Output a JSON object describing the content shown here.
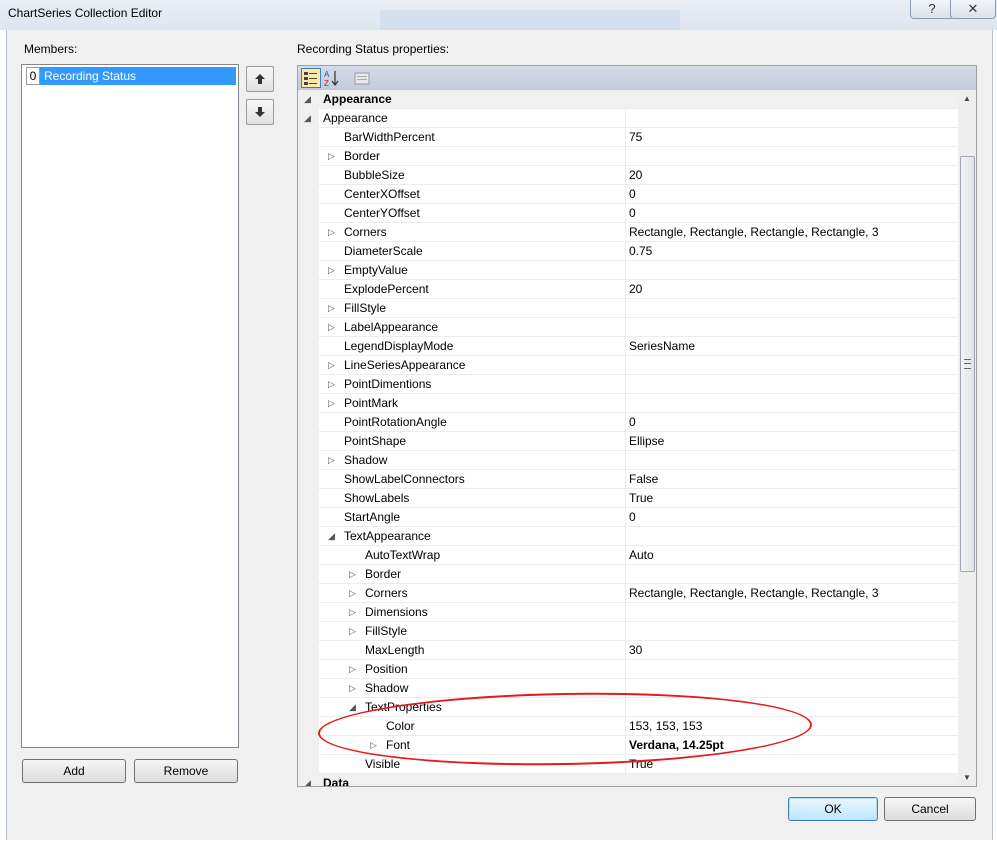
{
  "window": {
    "title": "ChartSeries Collection Editor",
    "help_glyph": "?",
    "close_glyph": "✕"
  },
  "members": {
    "label": "Members:",
    "items": [
      {
        "index": "0",
        "name": "Recording Status"
      }
    ],
    "move_up_icon": "arrow-up-icon",
    "move_down_icon": "arrow-down-icon"
  },
  "buttons": {
    "add": "Add",
    "remove": "Remove",
    "ok": "OK",
    "cancel": "Cancel"
  },
  "properties": {
    "label": "Recording Status properties:",
    "toolbar": [
      "categorized-icon",
      "alphabetical-icon",
      "property-pages-icon"
    ],
    "rows": [
      {
        "name": "Appearance",
        "value": "",
        "level": 0,
        "expander": "collapse",
        "category": true
      },
      {
        "name": "Appearance",
        "value": "",
        "level": 0,
        "expander": "collapse"
      },
      {
        "name": "BarWidthPercent",
        "value": "75",
        "level": 1,
        "expander": ""
      },
      {
        "name": "Border",
        "value": "",
        "level": 1,
        "expander": "expand"
      },
      {
        "name": "BubbleSize",
        "value": "20",
        "level": 1,
        "expander": ""
      },
      {
        "name": "CenterXOffset",
        "value": "0",
        "level": 1,
        "expander": ""
      },
      {
        "name": "CenterYOffset",
        "value": "0",
        "level": 1,
        "expander": ""
      },
      {
        "name": "Corners",
        "value": "Rectangle, Rectangle, Rectangle, Rectangle, 3",
        "level": 1,
        "expander": "expand"
      },
      {
        "name": "DiameterScale",
        "value": "0.75",
        "level": 1,
        "expander": ""
      },
      {
        "name": "EmptyValue",
        "value": "",
        "level": 1,
        "expander": "expand"
      },
      {
        "name": "ExplodePercent",
        "value": "20",
        "level": 1,
        "expander": ""
      },
      {
        "name": "FillStyle",
        "value": "",
        "level": 1,
        "expander": "expand"
      },
      {
        "name": "LabelAppearance",
        "value": "",
        "level": 1,
        "expander": "expand"
      },
      {
        "name": "LegendDisplayMode",
        "value": "SeriesName",
        "level": 1,
        "expander": ""
      },
      {
        "name": "LineSeriesAppearance",
        "value": "",
        "level": 1,
        "expander": "expand"
      },
      {
        "name": "PointDimentions",
        "value": "",
        "level": 1,
        "expander": "expand"
      },
      {
        "name": "PointMark",
        "value": "",
        "level": 1,
        "expander": "expand"
      },
      {
        "name": "PointRotationAngle",
        "value": "0",
        "level": 1,
        "expander": ""
      },
      {
        "name": "PointShape",
        "value": "Ellipse",
        "level": 1,
        "expander": ""
      },
      {
        "name": "Shadow",
        "value": "",
        "level": 1,
        "expander": "expand"
      },
      {
        "name": "ShowLabelConnectors",
        "value": "False",
        "level": 1,
        "expander": ""
      },
      {
        "name": "ShowLabels",
        "value": "True",
        "level": 1,
        "expander": ""
      },
      {
        "name": "StartAngle",
        "value": "0",
        "level": 1,
        "expander": ""
      },
      {
        "name": "TextAppearance",
        "value": "",
        "level": 1,
        "expander": "collapse"
      },
      {
        "name": "AutoTextWrap",
        "value": "Auto",
        "level": 2,
        "expander": ""
      },
      {
        "name": "Border",
        "value": "",
        "level": 2,
        "expander": "expand"
      },
      {
        "name": "Corners",
        "value": "Rectangle, Rectangle, Rectangle, Rectangle, 3",
        "level": 2,
        "expander": "expand"
      },
      {
        "name": "Dimensions",
        "value": "",
        "level": 2,
        "expander": "expand"
      },
      {
        "name": "FillStyle",
        "value": "",
        "level": 2,
        "expander": "expand"
      },
      {
        "name": "MaxLength",
        "value": "30",
        "level": 2,
        "expander": ""
      },
      {
        "name": "Position",
        "value": "",
        "level": 2,
        "expander": "expand"
      },
      {
        "name": "Shadow",
        "value": "",
        "level": 2,
        "expander": "expand"
      },
      {
        "name": "TextProperties",
        "value": "",
        "level": 2,
        "expander": "collapse"
      },
      {
        "name": "Color",
        "value": "153, 153, 153",
        "level": 3,
        "expander": ""
      },
      {
        "name": "Font",
        "value": "Verdana, 14.25pt",
        "level": 3,
        "expander": "expand",
        "bold_value": true
      },
      {
        "name": "Visible",
        "value": "True",
        "level": 2,
        "expander": ""
      },
      {
        "name": "Data",
        "value": "",
        "level": 0,
        "expander": "collapse",
        "category": true
      }
    ]
  },
  "colors": {
    "selection": "#3399ff",
    "annotation": "#e51a1a"
  }
}
